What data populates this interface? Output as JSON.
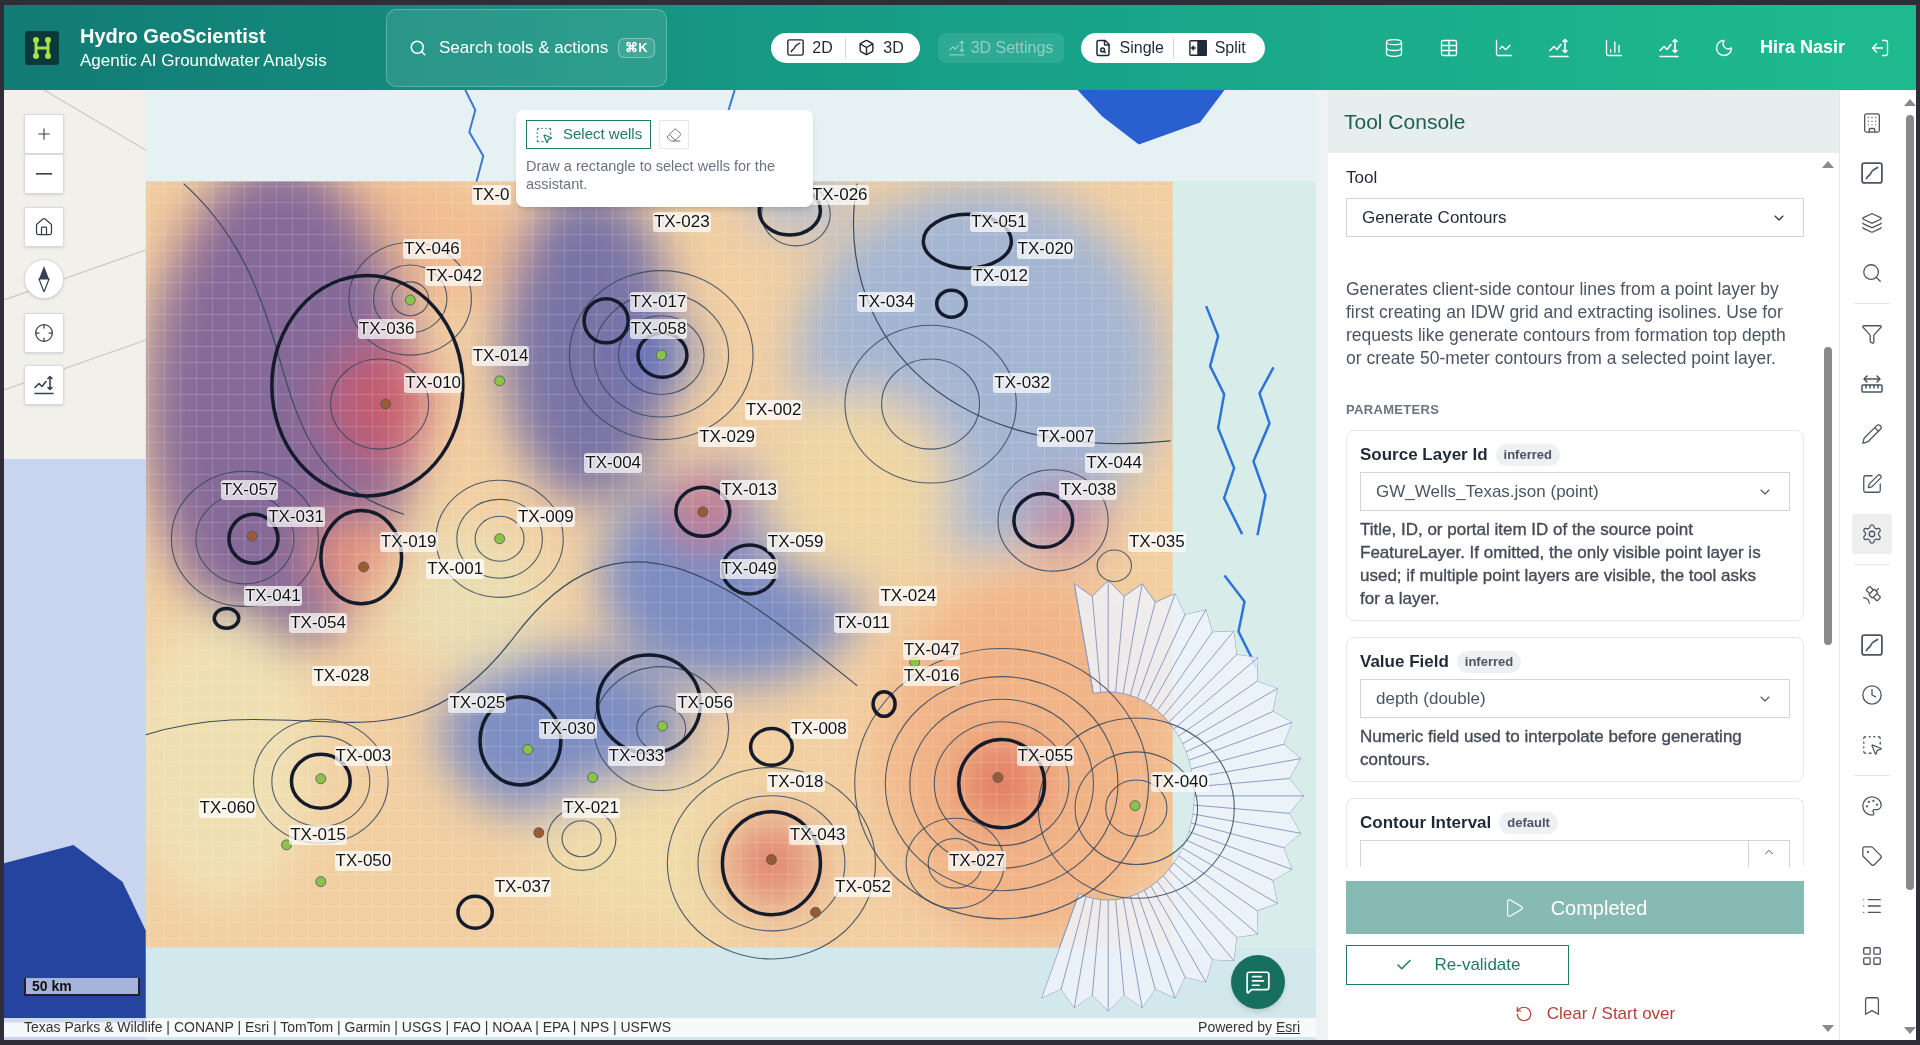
{
  "header": {
    "title": "Hydro GeoScientist",
    "subtitle": "Agentic AI Groundwater Analysis",
    "search": {
      "label": "Search tools & actions",
      "shortcut": "⌘K"
    },
    "view_modes": [
      "2D",
      "3D"
    ],
    "settings_button": {
      "label": "3D Settings",
      "disabled": true
    },
    "layouts": [
      "Single",
      "Split"
    ],
    "user_name": "Hira Nasir"
  },
  "map": {
    "select_tool": {
      "button": "Select wells",
      "hint": "Draw a rectangle to select wells for the assistant."
    },
    "well_labels": [
      "TX-0",
      "TX-026",
      "TX-023",
      "TX-051",
      "TX-046",
      "TX-020",
      "TX-042",
      "TX-012",
      "TX-017",
      "TX-034",
      "TX-036",
      "TX-058",
      "TX-014",
      "TX-010",
      "TX-032",
      "TX-002",
      "TX-029",
      "TX-007",
      "TX-004",
      "TX-044",
      "TX-057",
      "TX-013",
      "TX-038",
      "TX-031",
      "TX-009",
      "TX-019",
      "TX-059",
      "TX-035",
      "TX-001",
      "TX-049",
      "TX-041",
      "TX-024",
      "TX-054",
      "TX-011",
      "TX-047",
      "TX-028",
      "TX-016",
      "TX-025",
      "TX-056",
      "TX-030",
      "TX-008",
      "TX-003",
      "TX-033",
      "TX-055",
      "TX-018",
      "TX-040",
      "TX-060",
      "TX-021",
      "TX-015",
      "TX-043",
      "TX-050",
      "TX-027",
      "TX-037",
      "TX-052"
    ],
    "scale": "50 km",
    "attribution": "Texas Parks & Wildlife | CONANP | Esri | TomTom | Garmin | USGS | FAO | NOAA | EPA | NPS | USFWS",
    "powered_by": "Powered by",
    "powered_by_link": "Esri"
  },
  "tool_console": {
    "title": "Tool Console",
    "tool_label": "Tool",
    "tool": "Generate Contours",
    "description": "Generates client-side contour lines from a point layer by first creating an IDW grid and extracting isolines. Use for requests like generate contours from formation top depth or create 50-meter contours from a selected point layer.",
    "parameters_heading": "PARAMETERS",
    "parameters": [
      {
        "kind": "select",
        "label": "Source Layer Id",
        "badge": "inferred",
        "value": "GW_Wells_Texas.json (point)",
        "help": "Title, ID, or portal item ID of the source point FeatureLayer. If omitted, the only visible point layer is used; if multiple point layers are visible, the tool asks for a layer."
      },
      {
        "kind": "select",
        "label": "Value Field",
        "badge": "inferred",
        "value": "depth (double)",
        "help": "Numeric field used to interpolate before generating contours."
      },
      {
        "kind": "number",
        "label": "Contour Interval",
        "badge": "default"
      }
    ],
    "run_button": {
      "label": "Completed",
      "disabled": true
    },
    "revalidate_button": "Re-validate",
    "clear_button": "Clear / Start over"
  },
  "toolbar": [
    {
      "selected": false
    },
    {
      "selected": false
    },
    {
      "selected": false
    },
    {
      "selected": false
    },
    {
      "selected": false
    },
    {
      "selected": false
    },
    {
      "selected": false
    },
    {
      "selected": false
    },
    {
      "selected": true
    },
    {
      "selected": false
    },
    {
      "selected": false
    },
    {
      "selected": false
    },
    {
      "selected": false
    },
    {
      "selected": false
    },
    {
      "selected": false
    },
    {
      "selected": false
    },
    {
      "selected": false
    },
    {
      "selected": false
    }
  ]
}
